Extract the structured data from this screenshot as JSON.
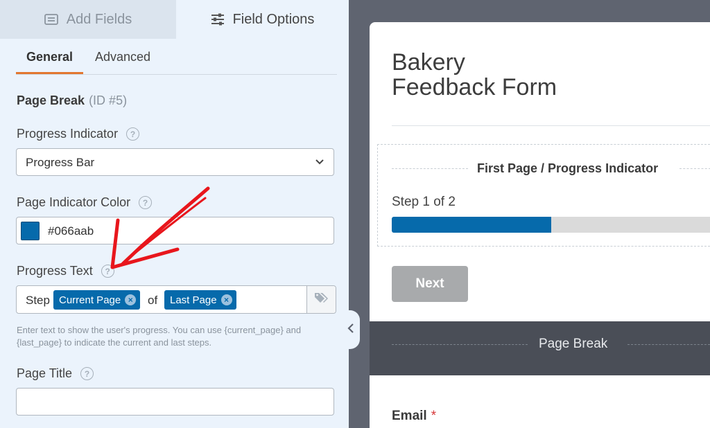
{
  "top_tabs": {
    "add_fields": "Add Fields",
    "field_options": "Field Options"
  },
  "sub_tabs": {
    "general": "General",
    "advanced": "Advanced"
  },
  "field": {
    "type_label": "Page Break",
    "id_label": "(ID #5)"
  },
  "progress_indicator": {
    "label": "Progress Indicator",
    "value": "Progress Bar"
  },
  "indicator_color": {
    "label": "Page Indicator Color",
    "value": "#066aab"
  },
  "progress_text": {
    "label": "Progress Text",
    "prefix": "Step",
    "tag1": "Current Page",
    "middle": "of",
    "tag2": "Last Page",
    "description": "Enter text to show the user's progress. You can use {current_page} and {last_page} to indicate the current and last steps."
  },
  "page_title": {
    "label": "Page Title",
    "value": ""
  },
  "preview": {
    "form_title_line1": "Bakery",
    "form_title_line2": "Feedback Form",
    "page_heading": "First Page / Progress Indicator",
    "step_text": "Step 1 of 2",
    "progress_fraction": 0.5,
    "next_button": "Next",
    "page_break_label": "Page Break",
    "email_label": "Email",
    "required_mark": "*"
  },
  "colors": {
    "accent": "#066aab",
    "tab_underline": "#e27730",
    "annotation_arrow": "#e8161c"
  },
  "icons": [
    "list-icon",
    "sliders-icon",
    "chevron-down-icon",
    "help-icon",
    "remove-tag-icon",
    "tags-icon",
    "collapse-chevron-icon"
  ]
}
